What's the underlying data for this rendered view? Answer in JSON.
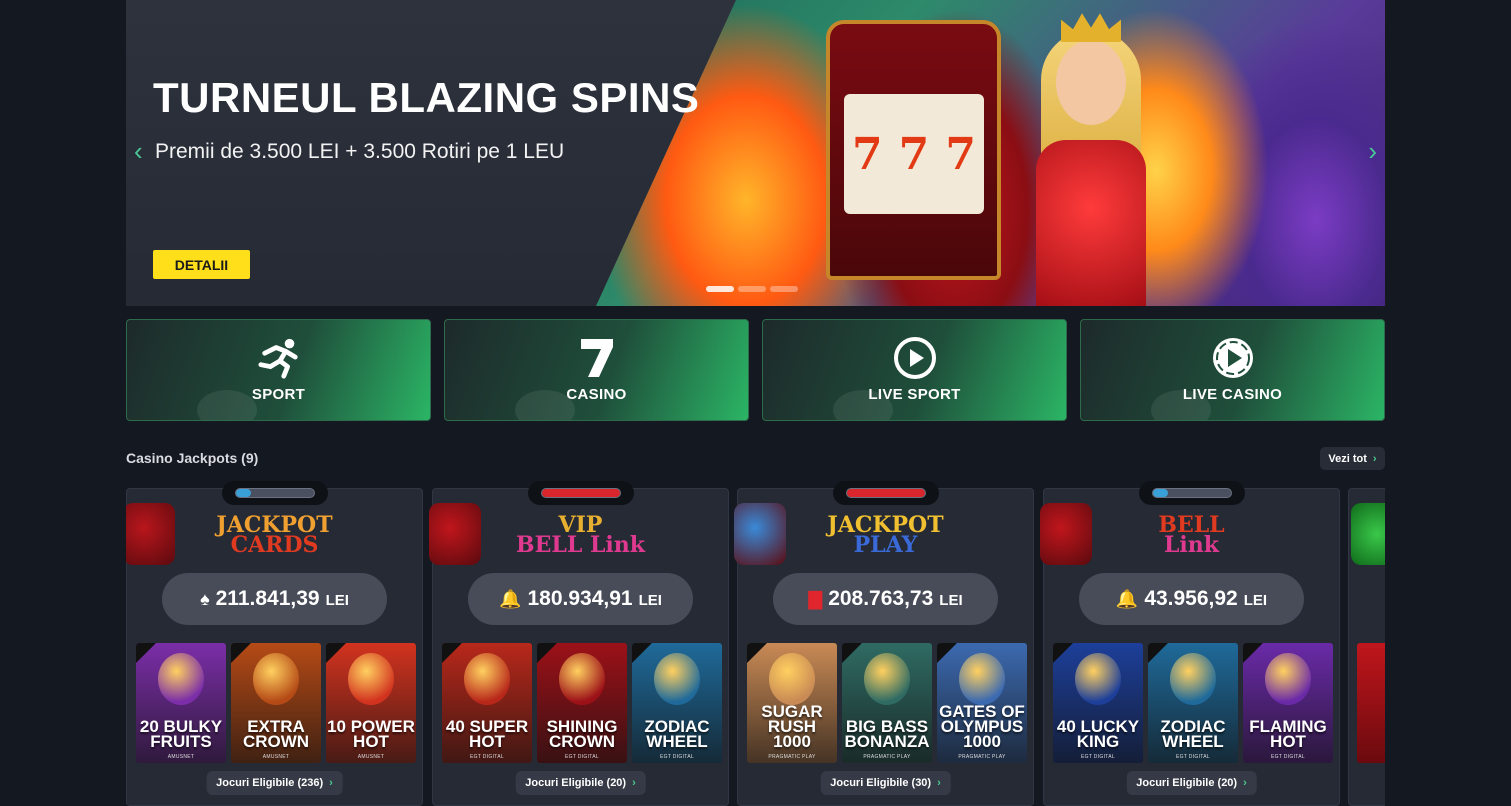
{
  "hero": {
    "title": "TURNEUL BLAZING SPINS",
    "subtitle": "Premii de 3.500 LEI + 3.500 Rotiri pe 1 LEU",
    "button": "DETALII",
    "prev_icon": "chevron-left-icon",
    "next_icon": "chevron-right-icon",
    "slide_count": 3,
    "active_slide": 1
  },
  "categories": [
    {
      "label": "SPORT",
      "icon": "running-icon"
    },
    {
      "label": "CASINO",
      "icon": "seven-icon"
    },
    {
      "label": "LIVE SPORT",
      "icon": "play-icon"
    },
    {
      "label": "LIVE CASINO",
      "icon": "play-icon"
    }
  ],
  "jackpots_section": {
    "title": "Casino Jackpots (9)",
    "see_all": "Vezi tot"
  },
  "jackpots": [
    {
      "logo_line1": "JACKPOT",
      "logo_line2": "CARDS",
      "amount": "211.841,39",
      "currency": "LEI",
      "suit_icon": "spade-icon",
      "meter_fill": 0.2,
      "meter_color": "#3aa0d8",
      "games": [
        {
          "title": "20 BULKY FRUITS",
          "sub": "AMUSNET",
          "bg": "#7b2ea8"
        },
        {
          "title": "EXTRA CROWN",
          "sub": "AMUSNET",
          "bg": "#b54a16"
        },
        {
          "title": "10 POWER HOT",
          "sub": "AMUSNET",
          "bg": "#d2331f"
        }
      ],
      "eligible": "Jocuri Eligibile (236)"
    },
    {
      "logo_line1": "VIP",
      "logo_line2": "BELL Link",
      "amount": "180.934,91",
      "currency": "LEI",
      "suit_icon": "bell-icon",
      "meter_fill": 1.0,
      "meter_color": "#d8262c",
      "games": [
        {
          "title": "40 SUPER HOT",
          "sub": "EGT DIGITAL",
          "bg": "#b8281a"
        },
        {
          "title": "SHINING CROWN",
          "sub": "EGT DIGITAL",
          "bg": "#9c1118"
        },
        {
          "title": "ZODIAC WHEEL",
          "sub": "EGT DIGITAL",
          "bg": "#1f6a9a"
        }
      ],
      "eligible": "Jocuri Eligibile (20)"
    },
    {
      "logo_line1": "JACKPOT",
      "logo_line2": "PLAY",
      "amount": "208.763,73",
      "currency": "LEI",
      "suit_icon": "bar-icon",
      "meter_fill": 1.0,
      "meter_color": "#d8262c",
      "games": [
        {
          "title": "SUGAR RUSH 1000",
          "sub": "PRAGMATIC PLAY",
          "bg": "#c98a55"
        },
        {
          "title": "BIG BASS BONANZA",
          "sub": "PRAGMATIC PLAY",
          "bg": "#2f6b63"
        },
        {
          "title": "GATES OF OLYMPUS 1000",
          "sub": "PRAGMATIC PLAY",
          "bg": "#3c6ab0"
        }
      ],
      "eligible": "Jocuri Eligibile (30)"
    },
    {
      "logo_line1": "BELL",
      "logo_line2": "Link",
      "amount": "43.956,92",
      "currency": "LEI",
      "suit_icon": "bell-icon",
      "meter_fill": 0.2,
      "meter_color": "#3aa0d8",
      "games": [
        {
          "title": "40 LUCKY KING",
          "sub": "EGT DIGITAL",
          "bg": "#1d3f9a"
        },
        {
          "title": "ZODIAC WHEEL",
          "sub": "EGT DIGITAL",
          "bg": "#1f6a9a"
        },
        {
          "title": "FLAMING HOT",
          "sub": "EGT DIGITAL",
          "bg": "#6a2aa8"
        }
      ],
      "eligible": "Jocuri Eligibile (20)"
    }
  ]
}
